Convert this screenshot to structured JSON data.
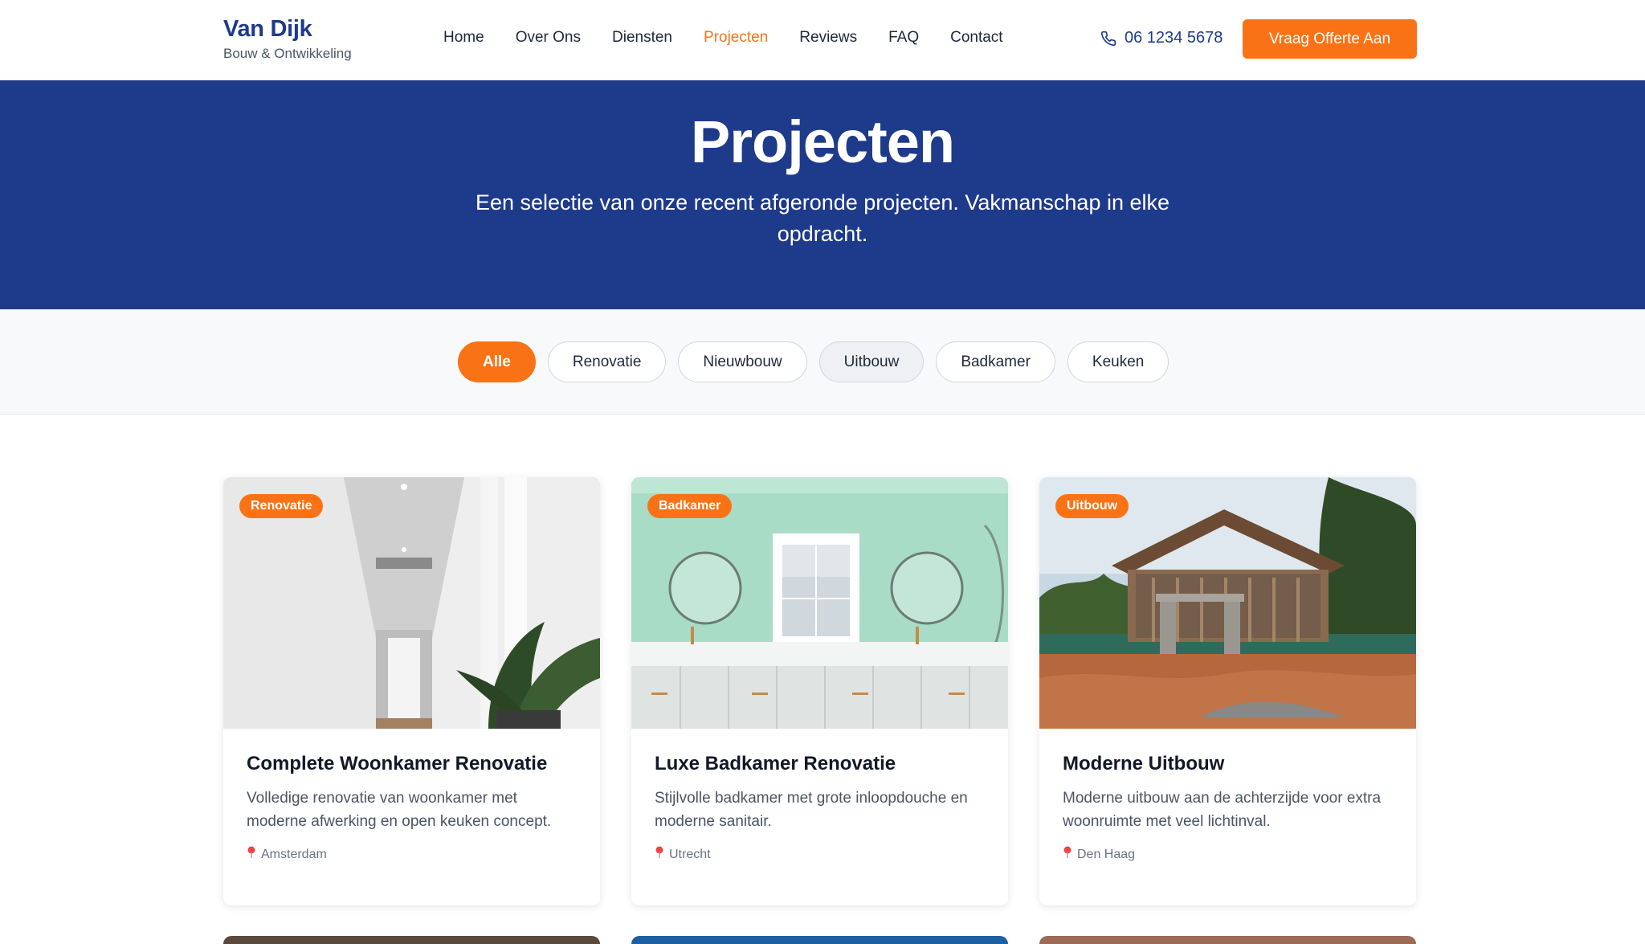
{
  "header": {
    "brand_name": "Van Dijk",
    "brand_sub": "Bouw & Ontwikkeling",
    "nav": [
      "Home",
      "Over Ons",
      "Diensten",
      "Projecten",
      "Reviews",
      "FAQ",
      "Contact"
    ],
    "active_nav": "Projecten",
    "phone": "06 1234 5678",
    "cta": "Vraag Offerte Aan"
  },
  "hero": {
    "title": "Projecten",
    "subtitle": "Een selectie van onze recent afgeronde projecten. Vakmanschap in elke opdracht."
  },
  "filters": [
    "Alle",
    "Renovatie",
    "Nieuwbouw",
    "Uitbouw",
    "Badkamer",
    "Keuken"
  ],
  "active_filter": "Alle",
  "projects": [
    {
      "tag": "Renovatie",
      "title": "Complete Woonkamer Renovatie",
      "description": "Volledige renovatie van woonkamer met moderne afwerking en open keuken concept.",
      "location": "Amsterdam"
    },
    {
      "tag": "Badkamer",
      "title": "Luxe Badkamer Renovatie",
      "description": "Stijlvolle badkamer met grote inloopdouche en moderne sanitair.",
      "location": "Utrecht"
    },
    {
      "tag": "Uitbouw",
      "title": "Moderne Uitbouw",
      "description": "Moderne uitbouw aan de achterzijde voor extra woonruimte met veel lichtinval.",
      "location": "Den Haag"
    }
  ],
  "colors": {
    "primary": "#1e3a8a",
    "accent": "#f97316"
  }
}
